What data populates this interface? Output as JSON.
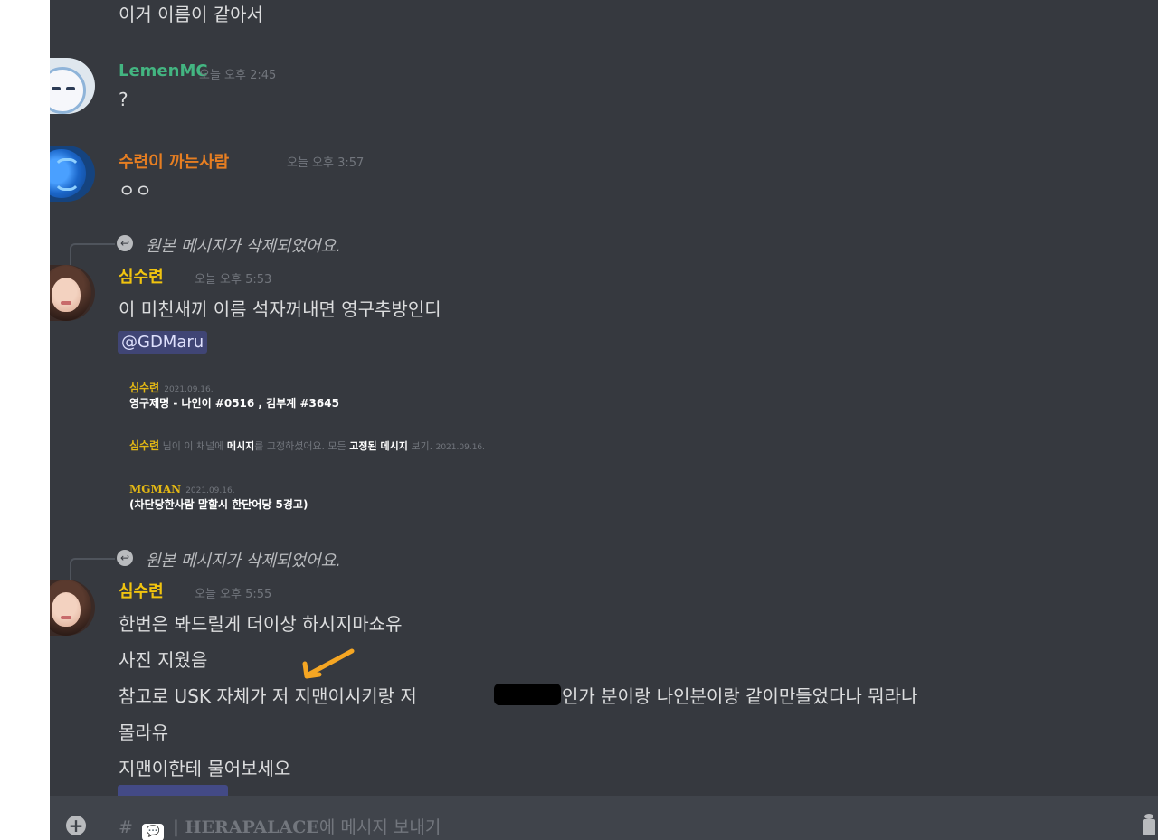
{
  "colors": {
    "bg": "#36393f",
    "lemenmc": "#43b581",
    "orange_user": "#e67e22",
    "yellow_user": "#f1c40f",
    "mention_bg": "#4a4f8c",
    "timestamp": "#72767d",
    "text": "#dcddde",
    "arrow": "#f5a623"
  },
  "messages": {
    "top_line": "이거 이름이 같아서",
    "m1": {
      "username": "LemenMC",
      "time": "오늘 오후 2:45",
      "text": "?"
    },
    "m2": {
      "username": "수련이 까는사람",
      "time": "오늘 오후 3:57",
      "text": "ㅇㅇ"
    },
    "m3": {
      "reply_text": "원본 메시지가 삭제되었어요.",
      "username": "심수련",
      "time": "오늘 오후 5:53",
      "text": "이 미친새끼 이름 석자꺼내면 영구추방인디",
      "mention": "@GDMaru",
      "embed": {
        "name1": "심수련",
        "date1": "2021.09.16.",
        "text1": "영구제명 - 나인이 #0516 , 김부계 #3645",
        "pin_user": "심수련",
        "pin_text_a": "님이 이 채널에",
        "pin_link_a": "메시지",
        "pin_text_b": "를 고정하셨어요. 모든",
        "pin_link_b": "고정된 메시지",
        "pin_text_c": "보기.",
        "pin_date": "2021.09.16.",
        "name2": "MGMAN",
        "date2": "2021.09.16.",
        "text2": "(차단당한사람 말할시 한단어당 5경고)"
      }
    },
    "m4": {
      "reply_text": "원본 메시지가 삭제되었어요.",
      "username": "심수련",
      "time": "오늘 오후 5:55",
      "line1": "한번은 봐드릴게 더이상 하시지마쇼유",
      "line2": "사진 지웠음",
      "line3a": "참고로 USK 자체가 저 지맨이시키랑 저",
      "line3b": "인가 분이랑 나인분이랑 같이만들었다나 뭐라나",
      "line4": "몰라유",
      "line5": "지맨이한테 물어보세오"
    }
  },
  "composer": {
    "hash": "#",
    "emoji": "💬",
    "channel": "| HERAPALACE",
    "suffix": "에 메시지 보내기",
    "plus_icon": "+",
    "reply_icon": "↩"
  }
}
